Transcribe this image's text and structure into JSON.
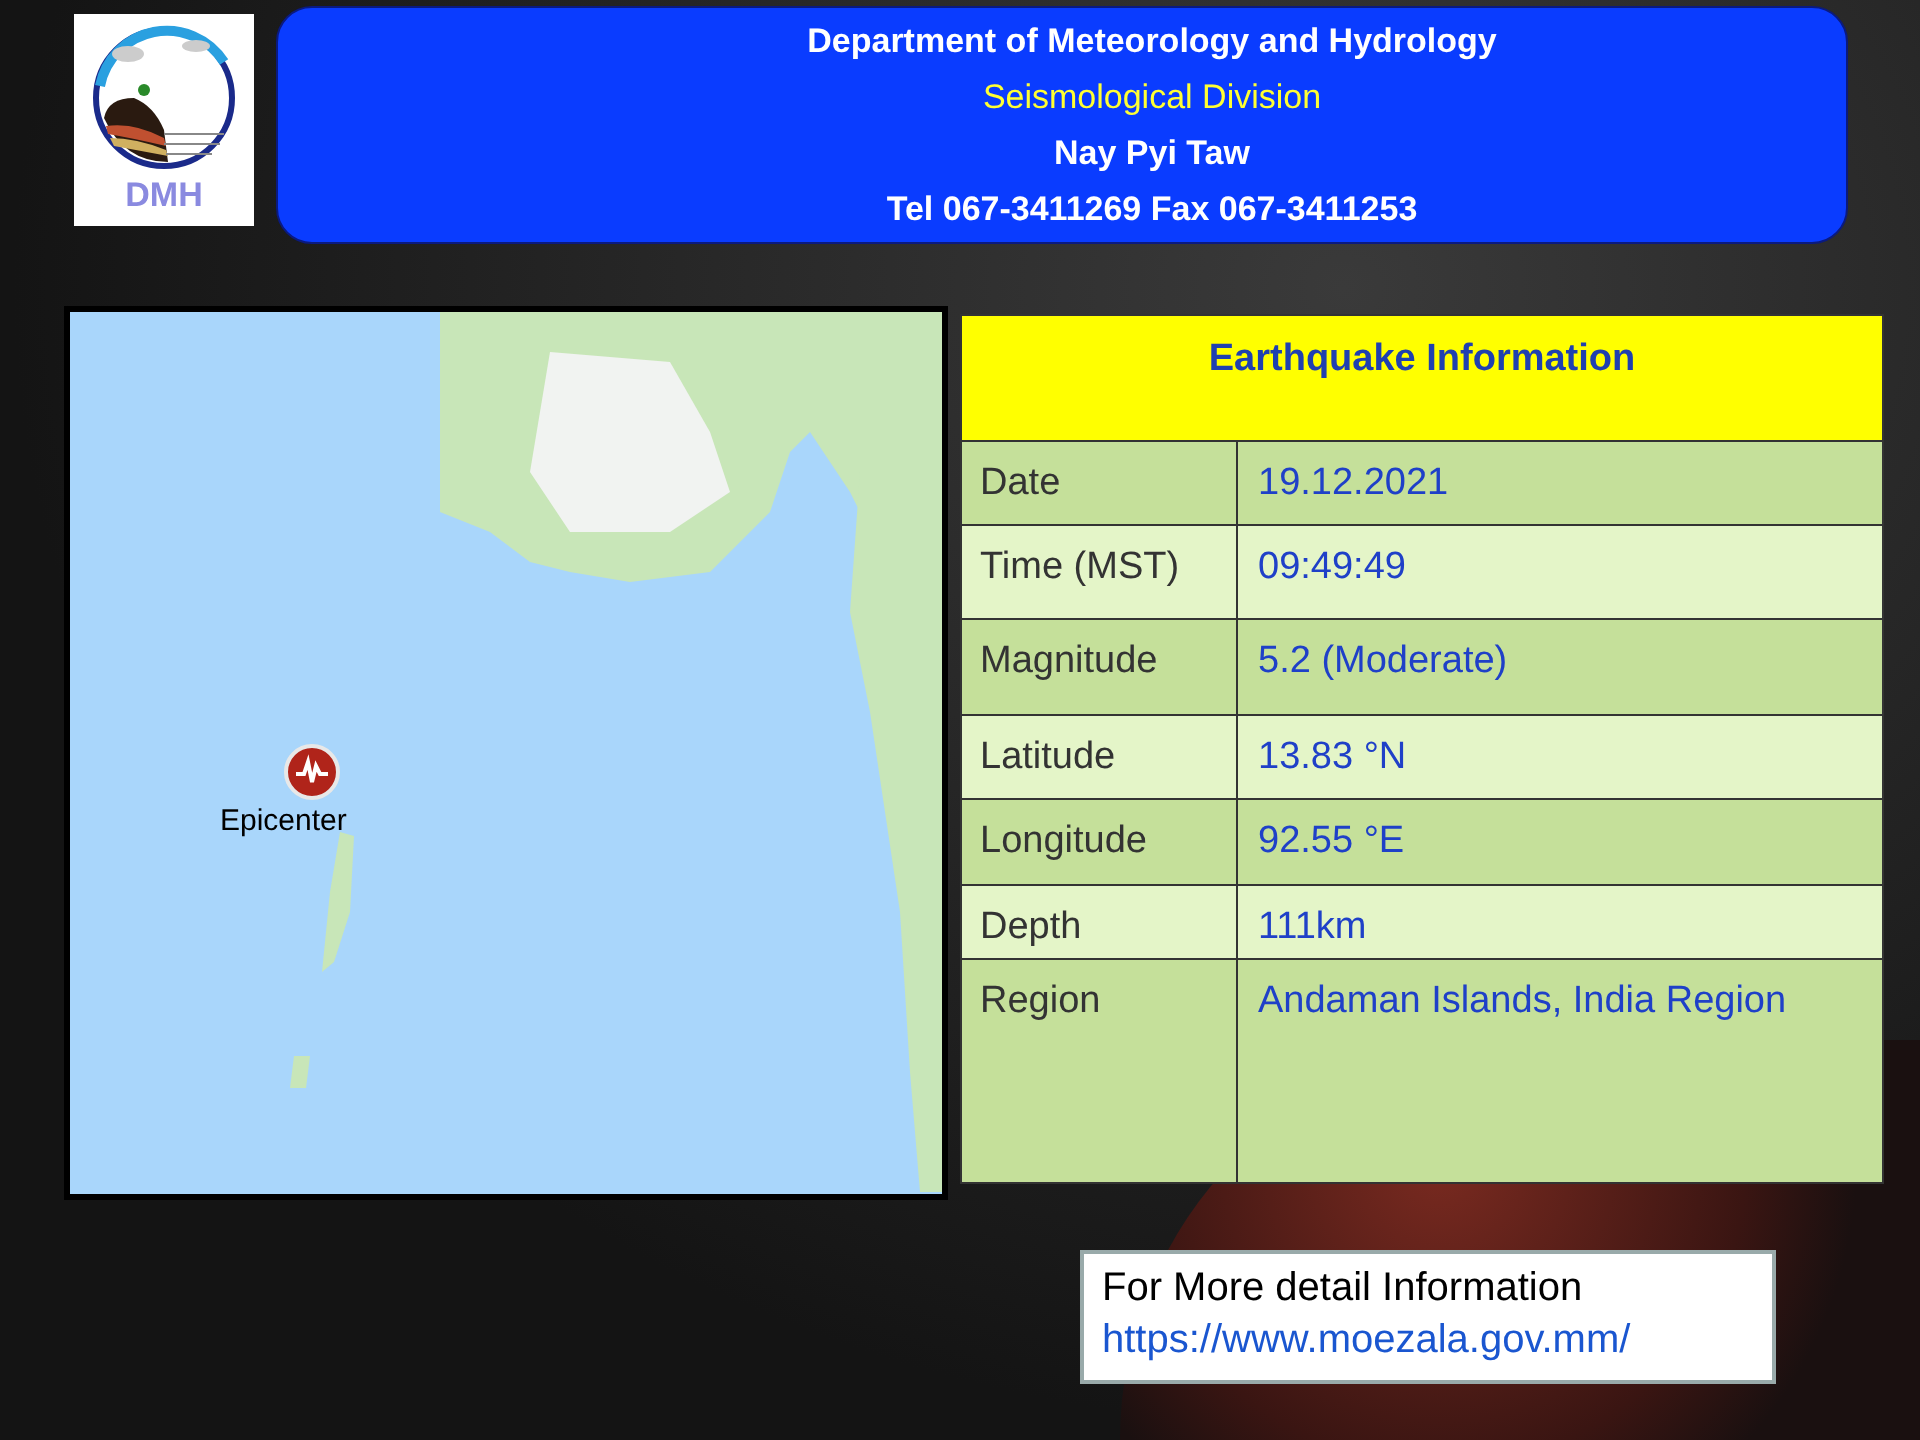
{
  "header": {
    "lines": [
      {
        "text": "Department of Meteorology and Hydrology",
        "kind": "title"
      },
      {
        "text": "Seismological Division",
        "kind": "division"
      },
      {
        "text": "Nay Pyi Taw",
        "kind": "plain"
      },
      {
        "text": "Tel 067-3411269 Fax 067-3411253",
        "kind": "plain"
      }
    ],
    "logo_text": "DMH"
  },
  "map": {
    "marker_label": "Epicenter"
  },
  "info_table": {
    "title": "Earthquake Information",
    "rows": [
      {
        "label": "Date",
        "value": "19.12.2021"
      },
      {
        "label": "Time (MST)",
        "value": "09:49:49"
      },
      {
        "label": "Magnitude",
        "value": "5.2 (Moderate)"
      },
      {
        "label": "Latitude",
        "value": "13.83 °N"
      },
      {
        "label": "Longitude",
        "value": "92.55 °E"
      },
      {
        "label": "Depth",
        "value": "111km"
      },
      {
        "label": "Region",
        "value": "Andaman Islands, India Region"
      }
    ]
  },
  "more_info": {
    "text": "For More detail Information",
    "link": "https://www.moezala.gov.mm/"
  }
}
